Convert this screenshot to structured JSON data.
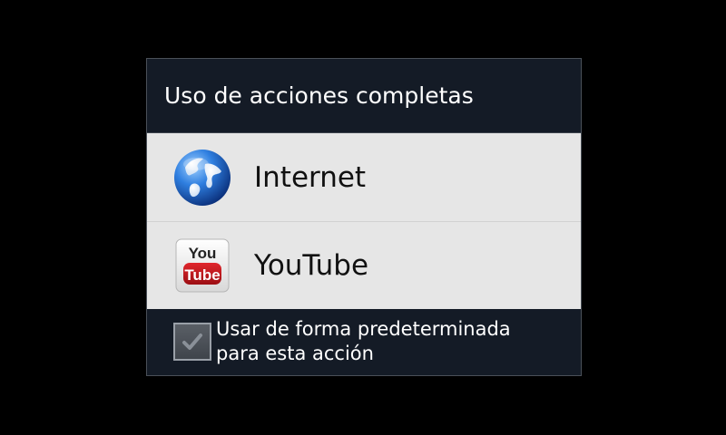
{
  "dialog": {
    "title": "Uso de acciones completas",
    "apps": [
      {
        "label": "Internet",
        "icon": "globe-icon"
      },
      {
        "label": "YouTube",
        "icon": "youtube-icon",
        "icon_text_top": "You",
        "icon_text_bottom": "Tube"
      }
    ],
    "default_checkbox": {
      "label": "Usar de forma predeterminada para esta acción",
      "checked": false,
      "icon": "checkmark-icon"
    }
  },
  "colors": {
    "background": "#000000",
    "dialog_dark": "#141b26",
    "list_background": "#e6e6e6",
    "youtube_red": "#c4161c"
  }
}
